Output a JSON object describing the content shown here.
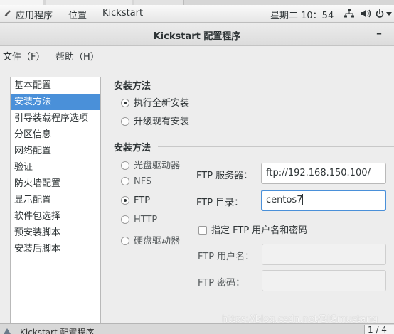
{
  "topbar": {
    "applications": "应用程序",
    "places": "位置",
    "active_app": "Kickstart",
    "clock": "星期二 10：54",
    "icons": [
      "network-icon",
      "volume-icon",
      "power-icon"
    ]
  },
  "window": {
    "title": "Kickstart 配置程序",
    "minimize": "–"
  },
  "menu": {
    "file": "文件（F）",
    "help": "帮助（H）"
  },
  "sidebar": {
    "items": [
      {
        "label": "基本配置"
      },
      {
        "label": "安装方法"
      },
      {
        "label": "引导装载程序选项"
      },
      {
        "label": "分区信息"
      },
      {
        "label": "网络配置"
      },
      {
        "label": "验证"
      },
      {
        "label": "防火墙配置"
      },
      {
        "label": "显示配置"
      },
      {
        "label": "软件包选择"
      },
      {
        "label": "预安装脚本"
      },
      {
        "label": "安装后脚本"
      }
    ],
    "selected": "安装方法"
  },
  "install_type": {
    "title": "安装方法",
    "options": [
      {
        "label": "执行全新安装",
        "checked": true
      },
      {
        "label": "升级现有安装",
        "checked": false
      }
    ]
  },
  "install_source": {
    "title": "安装方法",
    "options": [
      {
        "label": "光盘驱动器",
        "checked": false
      },
      {
        "label": "NFS",
        "checked": false
      },
      {
        "label": "FTP",
        "checked": true
      },
      {
        "label": "HTTP",
        "checked": false
      },
      {
        "label": "硬盘驱动器",
        "checked": false
      }
    ],
    "ftp_server_label": "FTP 服务器：",
    "ftp_server_value": "ftp://192.168.150.100/",
    "ftp_dir_label": "FTP 目录：",
    "ftp_dir_value": "centos7",
    "specify_user_label": "指定  FTP 用户名和密码",
    "specify_user_checked": false,
    "ftp_user_label": "FTP 用户名：",
    "ftp_user_value": "",
    "ftp_password_label": "FTP 密码：",
    "ftp_password_value": ""
  },
  "watermark": "https://blog.csdn.net/BIGmustang",
  "taskbar": {
    "task_label": "Kickstart 配置程序",
    "pager": "1 / 4"
  }
}
